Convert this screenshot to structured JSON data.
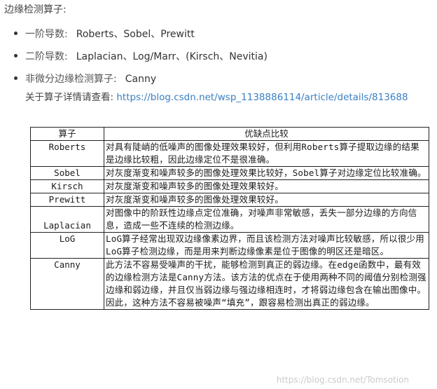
{
  "heading": "边缘检测算子:",
  "bullets": [
    {
      "label": "一阶导数:",
      "value": "Roberts、Sobel、Prewitt"
    },
    {
      "label": "二阶导数:",
      "value": "Laplacian、Log/Marr、(Kirsch、Nevitia)"
    },
    {
      "label": "非微分边缘检测算子:",
      "value": "Canny"
    }
  ],
  "detail": {
    "label": "关于算子详情请查看:",
    "url": "https://blog.csdn.net/wsp_1138886114/article/details/813688"
  },
  "table": {
    "headers": [
      "算子",
      "优缺点比较"
    ],
    "rows": [
      {
        "name": "Roberts",
        "desc": "对具有陡峭的低噪声的图像处理效果较好，但利用Roberts算子提取边缘的结果是边缘比较粗，因此边缘定位不是很准确。"
      },
      {
        "name": "Sobel",
        "desc": "对灰度渐变和噪声较多的图像处理效果比较好，Sobel算子对边缘定位比较准确。"
      },
      {
        "name": "Kirsch",
        "desc": "对灰度渐变和噪声较多的图像处理效果较好。"
      },
      {
        "name": "Prewitt",
        "desc": "对灰度渐变和噪声较多的图像处理效果较好。"
      },
      {
        "name": "Laplacian",
        "desc": "对图像中的阶跃性边缘点定位准确，对噪声非常敏感，丢失一部分边缘的方向信息，造成一些不连续的检测边缘。"
      },
      {
        "name": "LoG",
        "desc": "LoG算子经常出现双边缘像素边界，而且该检测方法对噪声比较敏感，所以很少用LoG算子检测边缘，而是用来判断边缘像素是位于图像的明区还是暗区。"
      },
      {
        "name": "Canny",
        "desc": "此方法不容易受噪声的干扰，能够检测到真正的弱边缘。在edge函数中，最有效的边缘检测方法是Canny方法。该方法的优点在于使用两种不同的阈值分别检测强边缘和弱边缘，并且仅当弱边缘与强边缘相连时，才将弱边缘包含在输出图像中。因此，这种方法不容易被噪声“填充”，跟容易检测出真正的弱边缘。"
      }
    ]
  },
  "watermark": "https://blog.csdn.net/Tomsotion"
}
